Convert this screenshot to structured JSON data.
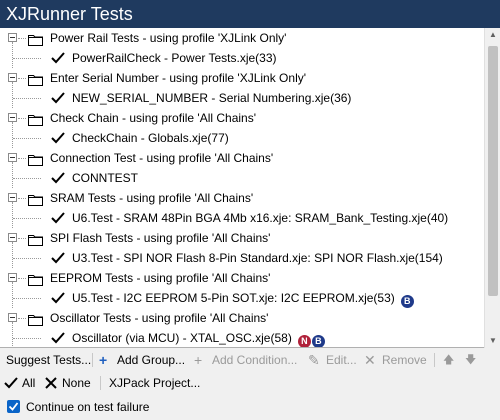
{
  "window": {
    "title": "XJRunner Tests"
  },
  "groups": [
    {
      "label": "Power Rail Tests - using profile 'XJLink Only'",
      "test": "PowerRailCheck - Power Tests.xje(33)",
      "badges": []
    },
    {
      "label": "Enter Serial Number - using profile 'XJLink Only'",
      "test": "NEW_SERIAL_NUMBER - Serial Numbering.xje(36)",
      "badges": []
    },
    {
      "label": "Check Chain - using profile 'All Chains'",
      "test": "CheckChain - Globals.xje(77)",
      "badges": []
    },
    {
      "label": "Connection Test - using profile 'All Chains'",
      "test": "CONNTEST",
      "badges": []
    },
    {
      "label": "SRAM Tests - using profile 'All Chains'",
      "test": "U6.Test - SRAM 48Pin BGA 4Mb x16.xje: SRAM_Bank_Testing.xje(40)",
      "badges": []
    },
    {
      "label": "SPI Flash Tests - using profile 'All Chains'",
      "test": "U3.Test - SPI NOR Flash 8-Pin Standard.xje: SPI NOR Flash.xje(154)",
      "badges": []
    },
    {
      "label": "EEPROM Tests - using profile 'All Chains'",
      "test": "U5.Test - I2C EEPROM 5-Pin SOT.xje: I2C EEPROM.xje(53)",
      "badges": [
        "B"
      ]
    },
    {
      "label": "Oscillator Tests - using profile 'All Chains'",
      "test": "Oscillator (via MCU) - XTAL_OSC.xje(58)",
      "badges": [
        "N",
        "B"
      ]
    }
  ],
  "toolbar": {
    "suggest": "Suggest Tests...",
    "add_group": "Add Group...",
    "add_condition": "Add Condition...",
    "edit": "Edit...",
    "remove": "Remove"
  },
  "toolbar2": {
    "all": "All",
    "none": "None",
    "xjpack": "XJPack Project..."
  },
  "options": {
    "continue_on_failure": "Continue on test failure",
    "continue_checked": true
  },
  "colors": {
    "titlebar": "#1f3a5f",
    "badge_b": "#1f3a8a",
    "badge_n": "#b0213a",
    "checkbox": "#0a64c8"
  }
}
